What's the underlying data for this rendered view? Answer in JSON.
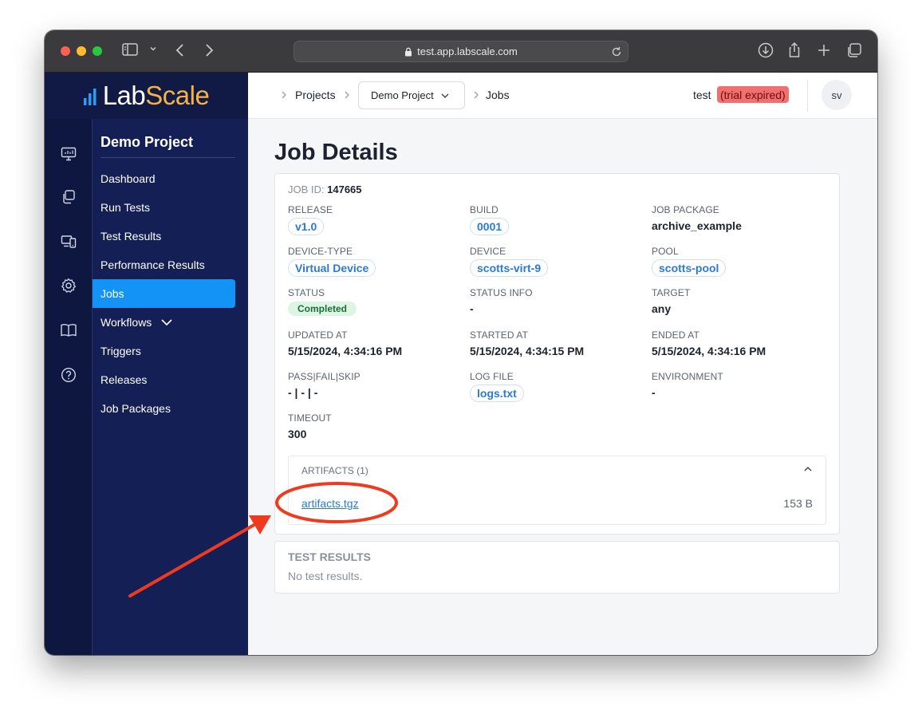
{
  "browser": {
    "url": "test.app.labscale.com"
  },
  "brand": {
    "part1": "Lab",
    "part2": "Scale"
  },
  "sidenav": {
    "project_title": "Demo Project",
    "items": [
      {
        "label": "Dashboard"
      },
      {
        "label": "Run Tests"
      },
      {
        "label": "Test Results"
      },
      {
        "label": "Performance Results"
      },
      {
        "label": "Jobs"
      },
      {
        "label": "Workflows"
      },
      {
        "label": "Triggers"
      },
      {
        "label": "Releases"
      },
      {
        "label": "Job Packages"
      }
    ]
  },
  "breadcrumb": {
    "projects": "Projects",
    "project": "Demo Project",
    "jobs": "Jobs"
  },
  "user": {
    "name": "test",
    "badge": "(trial expired)",
    "initials": "sv"
  },
  "page": {
    "title": "Job Details"
  },
  "job": {
    "id_label": "JOB ID:",
    "id_value": "147665",
    "fields": [
      {
        "label": "RELEASE",
        "value": "v1.0"
      },
      {
        "label": "BUILD",
        "value": "0001"
      },
      {
        "label": "JOB PACKAGE",
        "value": "archive_example"
      },
      {
        "label": "DEVICE-TYPE",
        "value": "Virtual Device"
      },
      {
        "label": "DEVICE",
        "value": "scotts-virt-9"
      },
      {
        "label": "POOL",
        "value": "scotts-pool"
      },
      {
        "label": "STATUS",
        "value": "Completed"
      },
      {
        "label": "STATUS INFO",
        "value": "-"
      },
      {
        "label": "TARGET",
        "value": "any"
      },
      {
        "label": "UPDATED AT",
        "value": "5/15/2024, 4:34:16 PM"
      },
      {
        "label": "STARTED AT",
        "value": "5/15/2024, 4:34:15 PM"
      },
      {
        "label": "ENDED AT",
        "value": "5/15/2024, 4:34:16 PM"
      },
      {
        "label": "PASS|FAIL|SKIP",
        "value": "- | - | -"
      },
      {
        "label": "LOG FILE",
        "value": "logs.txt"
      },
      {
        "label": "ENVIRONMENT",
        "value": "-"
      },
      {
        "label": "TIMEOUT",
        "value": "300"
      }
    ]
  },
  "artifacts": {
    "header": "ARTIFACTS (1)",
    "items": [
      {
        "name": "artifacts.tgz",
        "size": "153 B"
      }
    ]
  },
  "test_results": {
    "header": "TEST RESULTS",
    "empty": "No test results."
  },
  "colors": {
    "accent": "#1493f7",
    "sidebar": "#142055",
    "annotation": "#ee3b20"
  }
}
